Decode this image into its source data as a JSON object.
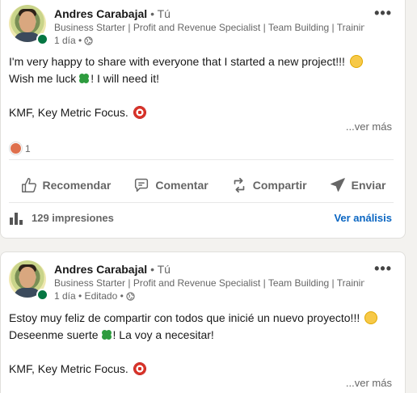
{
  "posts": [
    {
      "author_name": "Andres Carabajal",
      "author_tag": "• Tú",
      "headline": "Business Starter | Profit and Revenue Specialist | Team Building | Trainin...",
      "meta": "1 día •",
      "line1": "I'm very happy to share with everyone that I started a new project!!!",
      "line2a": "Wish me luck",
      "line2b": "! I will need it!",
      "line3": "KMF, Key Metric Focus.",
      "see_more": "...ver más",
      "reaction_count": "1",
      "actions": {
        "like": "Recomendar",
        "comment": "Comentar",
        "share": "Compartir",
        "send": "Enviar"
      },
      "impressions": "129 impresiones",
      "analytics": "Ver análisis"
    },
    {
      "author_name": "Andres Carabajal",
      "author_tag": "• Tú",
      "headline": "Business Starter | Profit and Revenue Specialist | Team Building | Trainin...",
      "meta": "1 día • Editado •",
      "line1": "Estoy muy feliz de compartir con todos que inicié un nuevo proyecto!!!",
      "line2a": "Deseenme suerte",
      "line2b": "! La voy a necesitar!",
      "line3": "KMF, Key Metric Focus.",
      "see_more": "...ver más"
    }
  ],
  "icons": {
    "more": "more-horizontal-icon",
    "globe": "globe-icon",
    "like": "thumbs-up-icon",
    "comment": "comment-icon",
    "share": "repost-icon",
    "send": "send-icon",
    "stats": "bar-chart-icon",
    "emoji_face": "smiling-face-emoji",
    "emoji_clover": "four-leaf-clover-emoji",
    "emoji_target": "direct-hit-emoji"
  },
  "colors": {
    "link": "#0a66c2",
    "presence": "#057642",
    "text": "#191919",
    "muted": "#666666"
  }
}
